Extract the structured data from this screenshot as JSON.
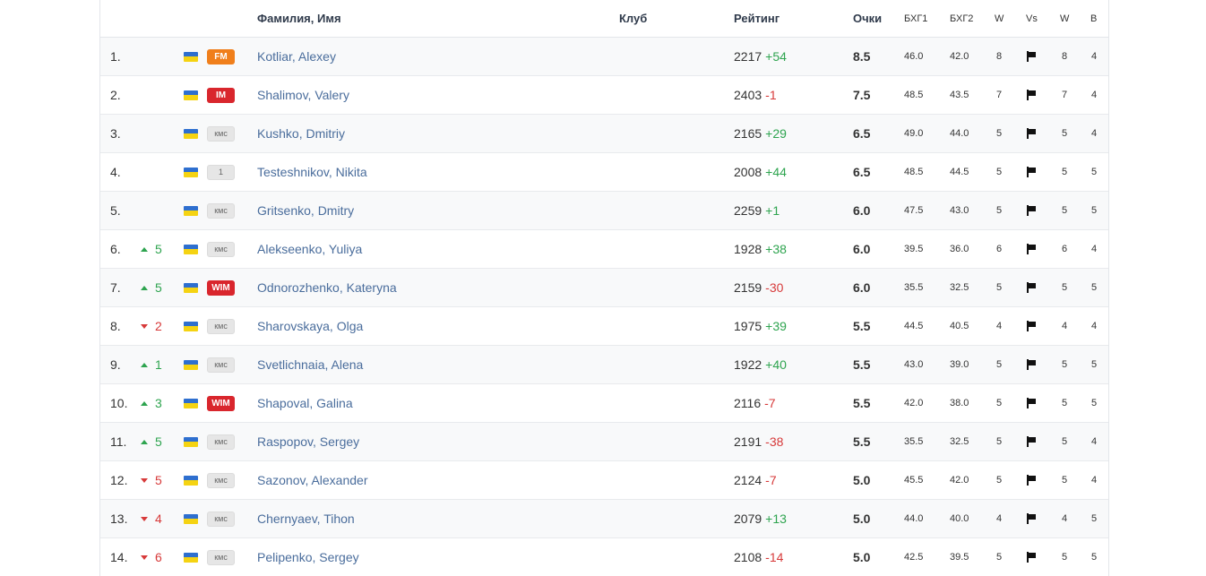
{
  "header": {
    "name": "Фамилия, Имя",
    "club": "Клуб",
    "rating": "Рейтинг",
    "points": "Очки",
    "bh1": "БХГ1",
    "bh2": "БХГ2",
    "w1": "W",
    "vs": "Vs",
    "w2": "W",
    "b": "B"
  },
  "rows": [
    {
      "place": "1.",
      "change": "",
      "dir": "",
      "title": "FM",
      "style": "orange",
      "name": "Kotliar, Alexey",
      "rating": "2217",
      "delta": "+54",
      "points": "8.5",
      "bh1": "46.0",
      "bh2": "42.0",
      "w1": "8",
      "w2": "8",
      "b": "4"
    },
    {
      "place": "2.",
      "change": "",
      "dir": "",
      "title": "IM",
      "style": "red",
      "name": "Shalimov, Valery",
      "rating": "2403",
      "delta": "-1",
      "points": "7.5",
      "bh1": "48.5",
      "bh2": "43.5",
      "w1": "7",
      "w2": "7",
      "b": "4"
    },
    {
      "place": "3.",
      "change": "",
      "dir": "",
      "title": "кмс",
      "style": "gray",
      "name": "Kushko, Dmitriy",
      "rating": "2165",
      "delta": "+29",
      "points": "6.5",
      "bh1": "49.0",
      "bh2": "44.0",
      "w1": "5",
      "w2": "5",
      "b": "4"
    },
    {
      "place": "4.",
      "change": "",
      "dir": "",
      "title": "1",
      "style": "gray",
      "name": "Testeshnikov, Nikita",
      "rating": "2008",
      "delta": "+44",
      "points": "6.5",
      "bh1": "48.5",
      "bh2": "44.5",
      "w1": "5",
      "w2": "5",
      "b": "5"
    },
    {
      "place": "5.",
      "change": "",
      "dir": "",
      "title": "кмс",
      "style": "gray",
      "name": "Gritsenko, Dmitry",
      "rating": "2259",
      "delta": "+1",
      "points": "6.0",
      "bh1": "47.5",
      "bh2": "43.0",
      "w1": "5",
      "w2": "5",
      "b": "5"
    },
    {
      "place": "6.",
      "change": "5",
      "dir": "up",
      "title": "кмс",
      "style": "gray",
      "name": "Alekseenko, Yuliya",
      "rating": "1928",
      "delta": "+38",
      "points": "6.0",
      "bh1": "39.5",
      "bh2": "36.0",
      "w1": "6",
      "w2": "6",
      "b": "4"
    },
    {
      "place": "7.",
      "change": "5",
      "dir": "up",
      "title": "WIM",
      "style": "red",
      "name": "Odnorozhenko, Kateryna",
      "rating": "2159",
      "delta": "-30",
      "points": "6.0",
      "bh1": "35.5",
      "bh2": "32.5",
      "w1": "5",
      "w2": "5",
      "b": "5"
    },
    {
      "place": "8.",
      "change": "2",
      "dir": "down",
      "title": "кмс",
      "style": "gray",
      "name": "Sharovskaya, Olga",
      "rating": "1975",
      "delta": "+39",
      "points": "5.5",
      "bh1": "44.5",
      "bh2": "40.5",
      "w1": "4",
      "w2": "4",
      "b": "4"
    },
    {
      "place": "9.",
      "change": "1",
      "dir": "up",
      "title": "кмс",
      "style": "gray",
      "name": "Svetlichnaia, Alena",
      "rating": "1922",
      "delta": "+40",
      "points": "5.5",
      "bh1": "43.0",
      "bh2": "39.0",
      "w1": "5",
      "w2": "5",
      "b": "5"
    },
    {
      "place": "10.",
      "change": "3",
      "dir": "up",
      "title": "WIM",
      "style": "red",
      "name": "Shapoval, Galina",
      "rating": "2116",
      "delta": "-7",
      "points": "5.5",
      "bh1": "42.0",
      "bh2": "38.0",
      "w1": "5",
      "w2": "5",
      "b": "5"
    },
    {
      "place": "11.",
      "change": "5",
      "dir": "up",
      "title": "кмс",
      "style": "gray",
      "name": "Raspopov, Sergey",
      "rating": "2191",
      "delta": "-38",
      "points": "5.5",
      "bh1": "35.5",
      "bh2": "32.5",
      "w1": "5",
      "w2": "5",
      "b": "4"
    },
    {
      "place": "12.",
      "change": "5",
      "dir": "down",
      "title": "кмс",
      "style": "gray",
      "name": "Sazonov, Alexander",
      "rating": "2124",
      "delta": "-7",
      "points": "5.0",
      "bh1": "45.5",
      "bh2": "42.0",
      "w1": "5",
      "w2": "5",
      "b": "4"
    },
    {
      "place": "13.",
      "change": "4",
      "dir": "down",
      "title": "кмс",
      "style": "gray",
      "name": "Chernyaev, Tihon",
      "rating": "2079",
      "delta": "+13",
      "points": "5.0",
      "bh1": "44.0",
      "bh2": "40.0",
      "w1": "4",
      "w2": "4",
      "b": "5"
    },
    {
      "place": "14.",
      "change": "6",
      "dir": "down",
      "title": "кмс",
      "style": "gray",
      "name": "Pelipenko, Sergey",
      "rating": "2108",
      "delta": "-14",
      "points": "5.0",
      "bh1": "42.5",
      "bh2": "39.5",
      "w1": "5",
      "w2": "5",
      "b": "5"
    }
  ],
  "icons": {
    "country": "ukraine-flag-icon",
    "vs": "flag-icon",
    "up": "arrow-up-icon",
    "down": "arrow-down-icon"
  },
  "colors": {
    "link": "#4a6d9c",
    "positive": "#2ea44f",
    "negative": "#d73a3a",
    "fm": "#f07f1b",
    "im": "#d9262d",
    "national": "#e6e6e6"
  }
}
